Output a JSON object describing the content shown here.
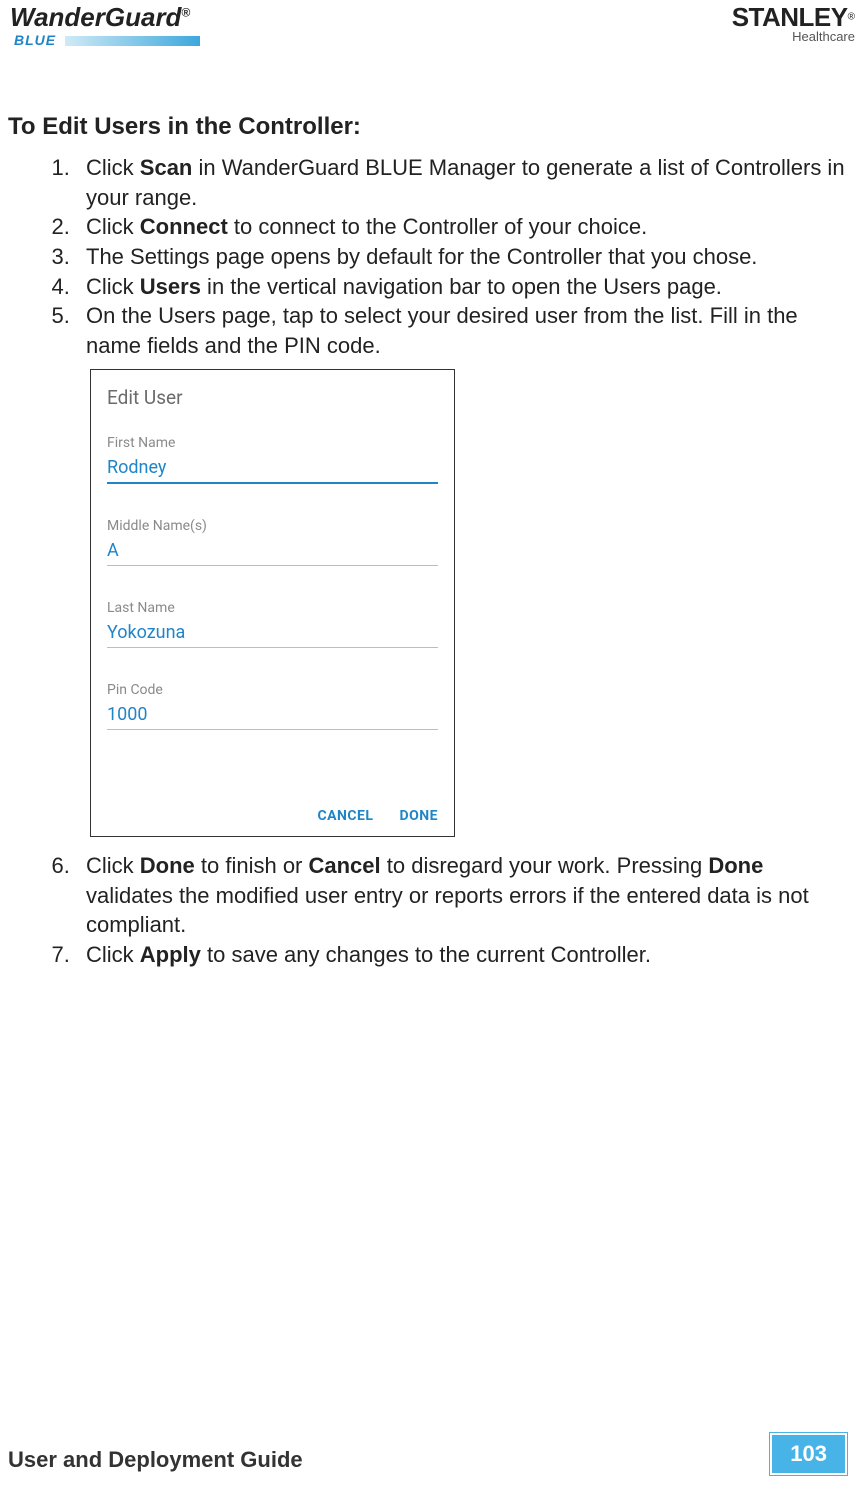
{
  "header": {
    "logo_left_main": "WanderGuard",
    "logo_left_reg": "®",
    "logo_left_sub": "BLUE",
    "logo_right_main": "STANLEY",
    "logo_right_reg": "®",
    "logo_right_sub": "Healthcare"
  },
  "section_title": "To Edit Users in the Controller:",
  "steps": {
    "s1_a": "Click ",
    "s1_b": "Scan",
    "s1_c": " in WanderGuard BLUE Manager to generate a list of Controllers in your range.",
    "s2_a": "Click ",
    "s2_b": "Connect",
    "s2_c": " to connect to the Controller of your choice.",
    "s3": "The Settings page opens by default for the Controller that you chose.",
    "s4_a": "Click ",
    "s4_b": "Users",
    "s4_c": " in the vertical navigation bar to open the Users page.",
    "s5": "On the Users page, tap to select your desired user from the list. Fill in the name fields and the PIN code.",
    "s6_a": "Click ",
    "s6_b": "Done",
    "s6_c": " to finish or ",
    "s6_d": "Cancel",
    "s6_e": " to disregard your work. Pressing ",
    "s6_f": "Done",
    "s6_g": " validates the modified user entry or reports errors if the entered data is not compliant.",
    "s7_a": "Click ",
    "s7_b": "Apply",
    "s7_c": " to save any changes to the current Controller."
  },
  "screenshot": {
    "title": "Edit User",
    "fields": {
      "first_name_label": "First Name",
      "first_name_value": "Rodney",
      "middle_name_label": "Middle Name(s)",
      "middle_name_value": "A",
      "last_name_label": "Last Name",
      "last_name_value": "Yokozuna",
      "pin_label": "Pin Code",
      "pin_value": "1000"
    },
    "buttons": {
      "cancel": "CANCEL",
      "done": "DONE"
    }
  },
  "footer": {
    "guide": "User and Deployment Guide",
    "page": "103"
  }
}
